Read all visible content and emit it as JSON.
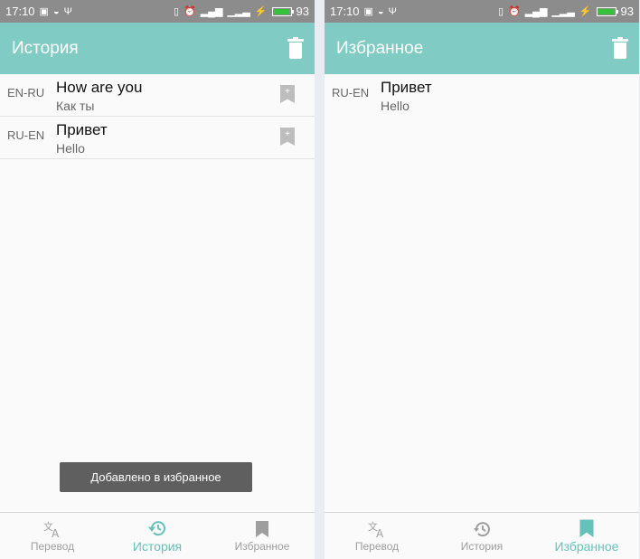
{
  "status_bar": {
    "time": "17:10",
    "battery": "93",
    "battery_level": 0.93
  },
  "left": {
    "title": "История",
    "items": [
      {
        "lang": "EN-RU",
        "source": "How are you",
        "translation": "Как ты"
      },
      {
        "lang": "RU-EN",
        "source": "Привет",
        "translation": "Hello"
      }
    ],
    "toast": "Добавлено в избранное",
    "nav": [
      {
        "label": "Перевод",
        "icon": "translate-icon",
        "active": false
      },
      {
        "label": "История",
        "icon": "history-icon",
        "active": true
      },
      {
        "label": "Избранное",
        "icon": "bookmark-icon",
        "active": false
      }
    ]
  },
  "right": {
    "title": "Избранное",
    "items": [
      {
        "lang": "RU-EN",
        "source": "Привет",
        "translation": "Hello"
      }
    ],
    "nav": [
      {
        "label": "Перевод",
        "icon": "translate-icon",
        "active": false
      },
      {
        "label": "История",
        "icon": "history-icon",
        "active": false
      },
      {
        "label": "Избранное",
        "icon": "bookmark-icon",
        "active": true
      }
    ]
  },
  "colors": {
    "accent": "#80cbc4",
    "active_nav": "#66c2b8",
    "statusbar": "#8c8c8c"
  }
}
